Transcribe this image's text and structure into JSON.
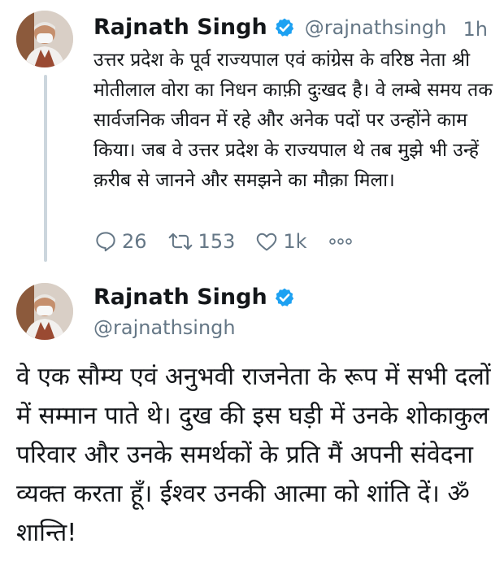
{
  "tweet1": {
    "author_name": "Rajnath Singh",
    "handle": "@rajnathsingh",
    "timestamp": "1h",
    "text": "उत्तर प्रदेश के पूर्व राज्यपाल एवं कांग्रेस के वरिष्ठ नेता श्री मोतीलाल वोरा का निधन काफ़ी दुःखद है। वे लम्बे समय तक सार्वजनिक जीवन में रहे और अनेक पदों पर उन्होंने काम किया। जब वे उत्तर प्रदेश के राज्यपाल थे तब मुझे भी उन्हें क़रीब से जानने और समझने का मौक़ा मिला।",
    "reply_count": "26",
    "retweet_count": "153",
    "like_count": "1k",
    "icons": [
      "reply-icon",
      "retweet-icon",
      "like-icon",
      "more-icon",
      "verified-badge-icon"
    ]
  },
  "tweet2": {
    "author_name": "Rajnath Singh",
    "handle": "@rajnathsingh",
    "text": "वे एक सौम्य एवं अनुभवी राजनेता के रूप में सभी दलों में सम्मान पाते थे। दुख की इस घड़ी में उनके शोकाकुल परिवार और उनके समर्थकों के प्रति मैं अपनी संवेदना व्यक्त करता हूँ। ईश्वर उनकी आत्मा को शांति दें। ॐ शान्ति!"
  },
  "colors": {
    "verified_blue": "#1da1f2",
    "secondary_text": "#657786",
    "primary_text": "#14171a",
    "thread_line": "#ccd6dd"
  }
}
